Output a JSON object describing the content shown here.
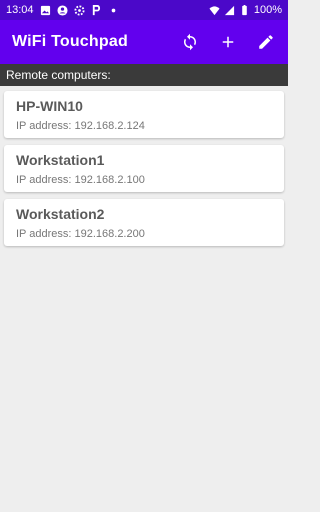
{
  "status_bar": {
    "time": "13:04",
    "battery": "100%",
    "icons_left": [
      "image-icon",
      "account-icon",
      "settings-icon",
      "parking-icon",
      "dot-icon"
    ],
    "icons_right": [
      "wifi-icon",
      "signal-icon",
      "battery-icon"
    ]
  },
  "app_bar": {
    "title": "WiFi Touchpad",
    "actions": [
      "refresh-icon",
      "add-icon",
      "edit-icon"
    ],
    "color": "#6200ee"
  },
  "section": {
    "label": "Remote computers:"
  },
  "computers": [
    {
      "name": "HP-WIN10",
      "ip": "IP address: 192.168.2.124"
    },
    {
      "name": "Workstation1",
      "ip": "IP address: 192.168.2.100"
    },
    {
      "name": "Workstation2",
      "ip": "IP address: 192.168.2.200"
    }
  ]
}
